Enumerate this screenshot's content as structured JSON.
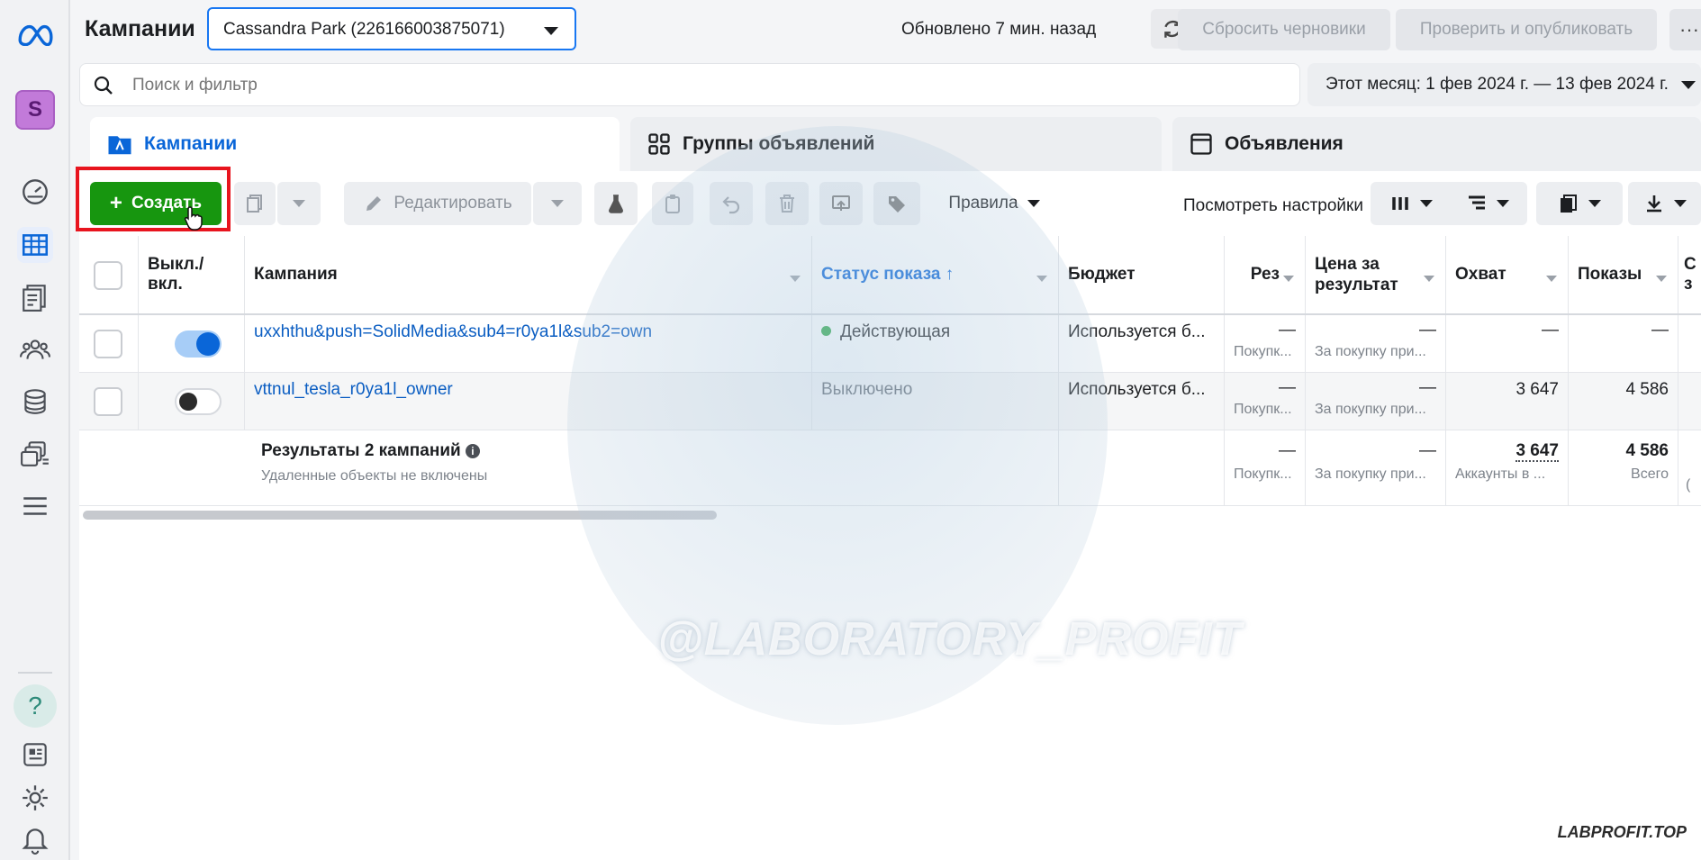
{
  "header": {
    "title": "Кампании",
    "account": "Cassandra Park (226166003875071)",
    "updated": "Обновлено 7 мин. назад",
    "discard_label": "Сбросить черновики",
    "publish_label": "Проверить и опубликовать",
    "more_label": "···"
  },
  "search": {
    "placeholder": "Поиск и фильтр",
    "date_range": "Этот месяц: 1 фев 2024 г. — 13 фев 2024 г."
  },
  "tabs": {
    "campaigns": "Кампании",
    "ad_sets": "Группы объявлений",
    "ads": "Объявления"
  },
  "toolbar": {
    "create_label": "Создать",
    "edit_label": "Редактировать",
    "rules_label": "Правила",
    "view_settings_label": "Посмотреть настройки"
  },
  "table": {
    "headers": {
      "onoff": "Выкл./ вкл.",
      "campaign": "Кампания",
      "delivery": "Статус показа ↑",
      "budget": "Бюджет",
      "results": "Рез",
      "cost": "Цена за результат",
      "reach": "Охват",
      "impressions": "Показы",
      "next": "С з"
    },
    "rows": [
      {
        "name": "uxxhthu&push=SolidMedia&sub4=r0ya1l&sub2=own",
        "status": "Действующая",
        "budget": "Используется б...",
        "results": "—",
        "results_sub": "Покупк...",
        "cost": "—",
        "cost_sub": "За покупку при...",
        "reach": "—",
        "impressions": "—"
      },
      {
        "name": "vttnul_tesla_r0ya1l_owner",
        "status": "Выключено",
        "budget": "Используется б...",
        "results": "—",
        "results_sub": "Покупк...",
        "cost": "—",
        "cost_sub": "За покупку при...",
        "reach": "3 647",
        "impressions": "4 586"
      }
    ],
    "totals": {
      "label": "Результаты 2 кампаний",
      "note": "Удаленные объекты не включены",
      "results": "—",
      "results_sub": "Покупк...",
      "cost": "—",
      "cost_sub": "За покупку при...",
      "reach": "3 647",
      "reach_sub": "Аккаунты в ...",
      "impressions": "4 586",
      "impressions_sub": "Всего",
      "edge": "("
    }
  },
  "watermark": {
    "center": "@LABORATORY_PROFIT",
    "corner": "LABPROFIT.TOP"
  },
  "colors": {
    "accent": "#0a66d8",
    "create": "#17960f",
    "highlight": "#e8141e",
    "active_dot": "#2aa644"
  }
}
